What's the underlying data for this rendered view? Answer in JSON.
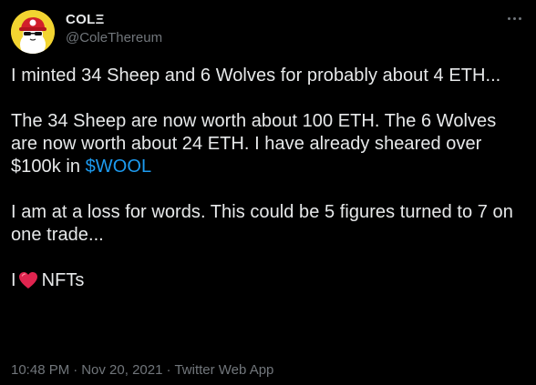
{
  "author": {
    "display_name": "COLΞ",
    "handle": "@ColeThereum",
    "avatar_icon": "sheep-with-red-cap-avatar"
  },
  "tweet": {
    "paragraphs": {
      "p1": "I minted 34 Sheep and 6 Wolves for probably about 4 ETH...",
      "p2_before_link": "The 34 Sheep are now worth about 100 ETH. The 6 Wolves are now worth about 24 ETH. I have already sheared over $100k in ",
      "p2_link": "$WOOL",
      "p3": "I am at a loss for words. This could be 5 figures turned to 7 on one trade...",
      "p4_before_emoji": "I",
      "p4_emoji_icon": "red-heart-emoji",
      "p4_after_emoji": "NFTs"
    },
    "time": "10:48 PM",
    "date": "Nov 20, 2021",
    "separator": "·",
    "source": "Twitter Web App"
  },
  "colors": {
    "background": "#000000",
    "text": "#e7e9ea",
    "muted": "#71767b",
    "link": "#1d9bf0",
    "avatar_bg": "#f2d431",
    "heart": "#e0244f"
  },
  "more_icon": "more-dots-icon"
}
